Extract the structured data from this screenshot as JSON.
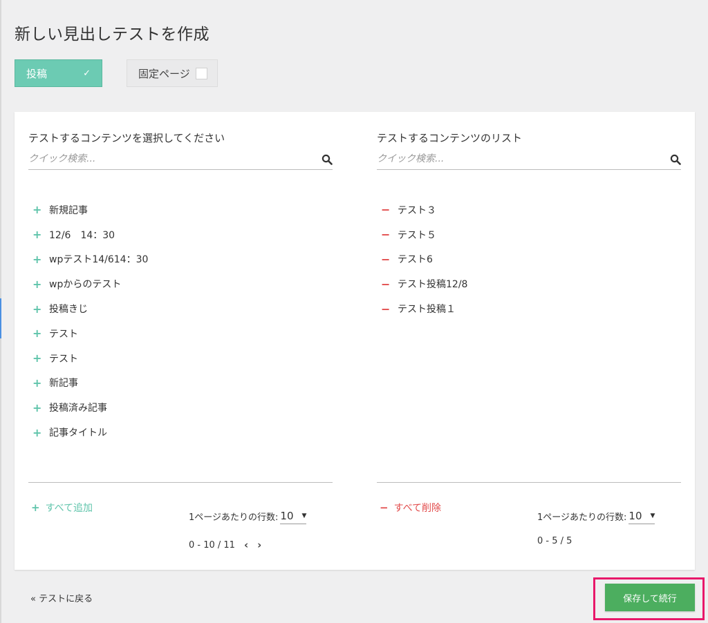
{
  "page": {
    "title": "新しい見出しテストを作成"
  },
  "type_tabs": {
    "post_label": "投稿",
    "page_label": "固定ページ"
  },
  "left": {
    "title": "テストするコンテンツを選択してください",
    "search_placeholder": "クイック検索...",
    "items": [
      "新規記事",
      "12/6　14：30",
      "wpテスト14/614：30",
      "wpからのテスト",
      "投稿きじ",
      "テスト",
      "テスト",
      "新記事",
      "投稿済み記事",
      "記事タイトル"
    ],
    "bulk_label": "すべて追加",
    "rows_label": "1ページあたりの行数:",
    "rows_value": "10",
    "pager_text": "0 - 10 / 11"
  },
  "right": {
    "title": "テストするコンテンツのリスト",
    "search_placeholder": "クイック検索...",
    "items": [
      "テスト３",
      "テスト５",
      "テスト6",
      "テスト投稿12/8",
      "テスト投稿１"
    ],
    "bulk_label": "すべて削除",
    "rows_label": "1ページあたりの行数:",
    "rows_value": "10",
    "pager_text": "0 - 5 / 5"
  },
  "footer": {
    "back_label": "« テストに戻る",
    "save_label": "保存して続行"
  },
  "icons": {
    "add": "plus-icon",
    "remove": "minus-icon",
    "search": "search-icon",
    "check": "check-icon"
  },
  "colors": {
    "accent_teal": "#6ccbb3",
    "remove_red": "#e24a4a",
    "save_green": "#4cae5f",
    "highlight": "#e8186a"
  }
}
